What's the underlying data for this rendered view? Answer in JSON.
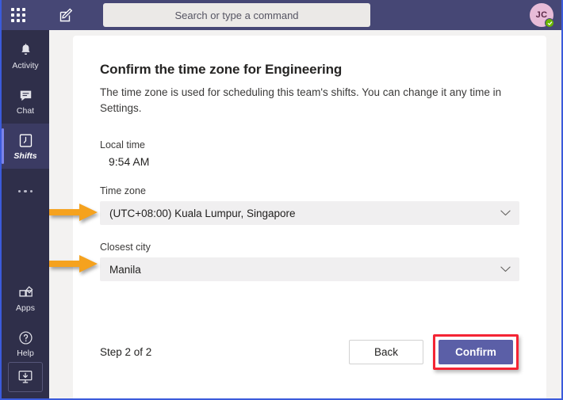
{
  "topbar": {
    "waffle_icon": "app-grid-icon",
    "compose_icon": "compose-pencil-icon",
    "search_placeholder": "Search or type a command",
    "avatar_initials": "JC",
    "presence_status": "available"
  },
  "rail": {
    "items": [
      {
        "label": "Activity",
        "icon": "bell-icon",
        "selected": false
      },
      {
        "label": "Chat",
        "icon": "chat-bubble-icon",
        "selected": false
      },
      {
        "label": "Shifts",
        "icon": "clock-icon",
        "selected": true
      },
      {
        "label": "",
        "icon": "more-ellipsis-icon",
        "selected": false
      }
    ],
    "bottom_items": [
      {
        "label": "Apps",
        "icon": "apps-icon"
      },
      {
        "label": "Help",
        "icon": "help-question-icon"
      }
    ],
    "download_icon": "download-app-icon"
  },
  "main": {
    "title": "Confirm the time zone for Engineering",
    "subtitle": "The time zone is used for scheduling this team's shifts. You can change it any time in Settings.",
    "local_time_label": "Local time",
    "local_time_value": "9:54 AM",
    "time_zone_label": "Time zone",
    "time_zone_value": "(UTC+08:00) Kuala Lumpur, Singapore",
    "closest_city_label": "Closest city",
    "closest_city_value": "Manila",
    "step_text": "Step 2 of 2",
    "back_label": "Back",
    "confirm_label": "Confirm"
  },
  "colors": {
    "topbar": "#464775",
    "rail": "#2f2f4a",
    "rail_selected": "#3b3b63",
    "accent": "#7b83eb",
    "primary_button": "#5b5fa7",
    "annotation_red": "#f42434",
    "annotation_orange": "#f5a21e",
    "presence_green": "#6bb700",
    "field_bg": "#f0eff0",
    "window_border": "#3b5bdb"
  }
}
